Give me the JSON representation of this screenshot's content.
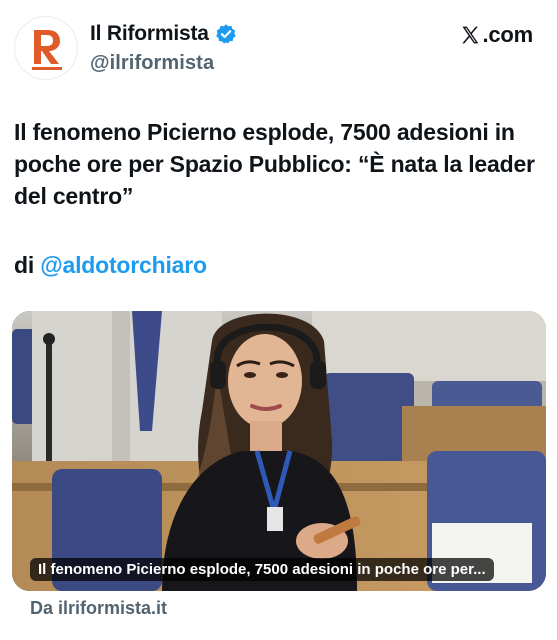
{
  "account": {
    "name": "Il Riformista",
    "handle": "@ilriformista",
    "avatar_letter": "R",
    "brand_color": "#e05a2a",
    "verified_color": "#1d9bf0",
    "verified_icon": "verified-badge-icon"
  },
  "platform": {
    "label": ".com",
    "icon": "x-logo-icon"
  },
  "tweet": {
    "text": "Il fenomeno Picierno esplode, 7500 adesioni in poche ore per Spazio Pubblico: “È nata la leader del centro”",
    "byline_prefix": "di",
    "byline_mention": "@aldotorchiaro",
    "mention_color": "#1d9bf0"
  },
  "card": {
    "image_icon": "article-photo",
    "caption": "Il fenomeno Picierno esplode, 7500 adesioni in poche ore per...",
    "source": "Da ilriformista.it"
  }
}
